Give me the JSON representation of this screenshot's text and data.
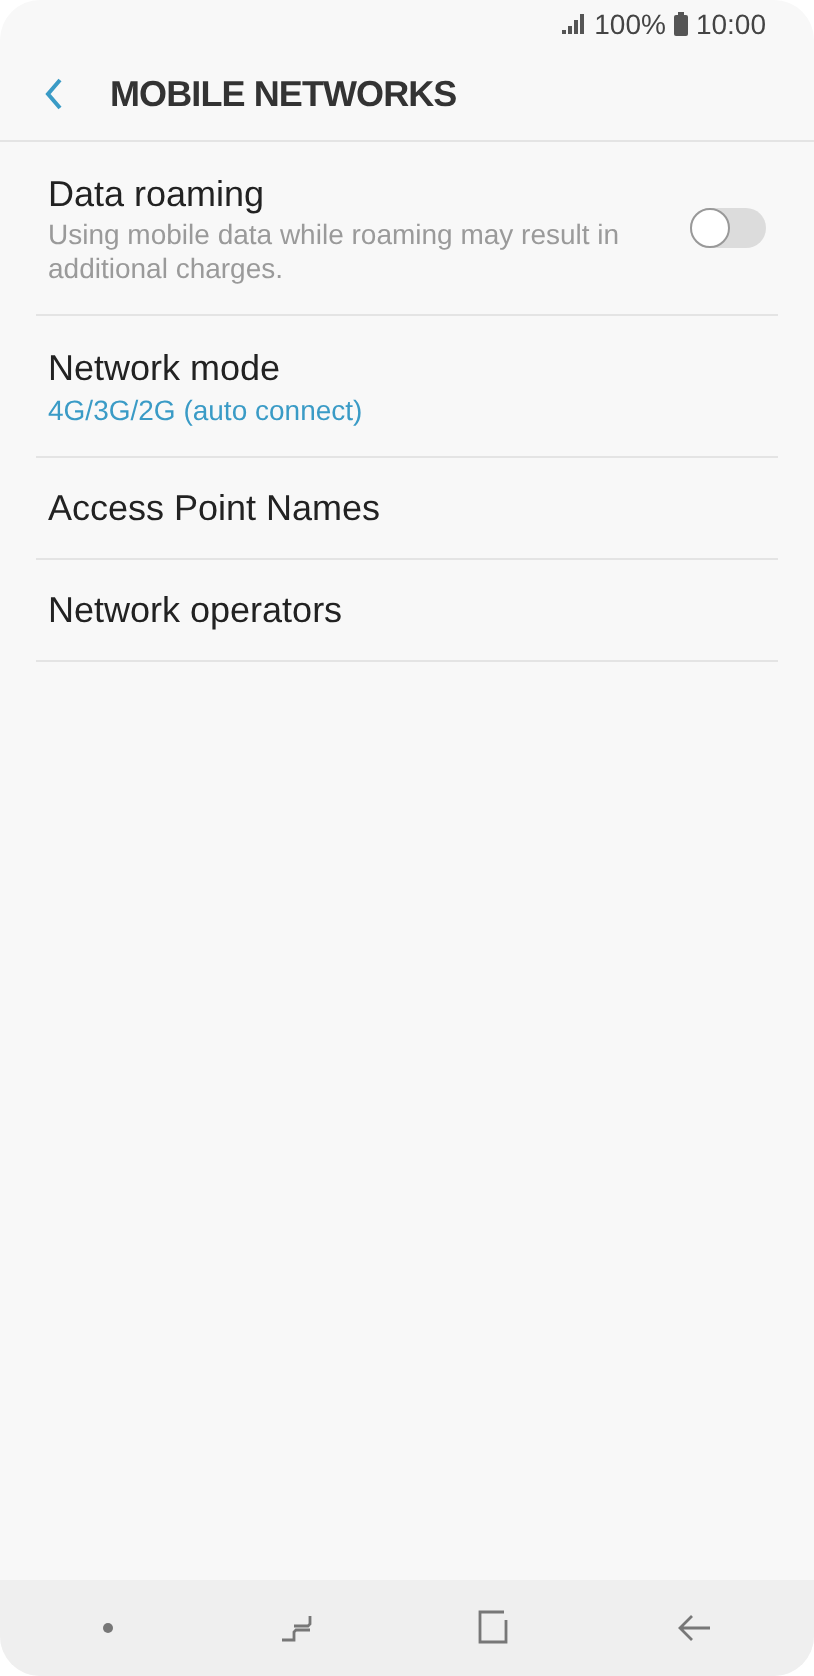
{
  "status_bar": {
    "battery": "100%",
    "time": "10:00"
  },
  "header": {
    "title": "MOBILE NETWORKS"
  },
  "items": [
    {
      "kind": "toggle",
      "title": "Data roaming",
      "subtitle": "Using mobile data while roaming may result in additional charges.",
      "on": false
    },
    {
      "kind": "value",
      "title": "Network mode",
      "value": "4G/3G/2G (auto connect)"
    },
    {
      "kind": "plain",
      "title": "Access Point Names"
    },
    {
      "kind": "plain",
      "title": "Network operators"
    }
  ]
}
